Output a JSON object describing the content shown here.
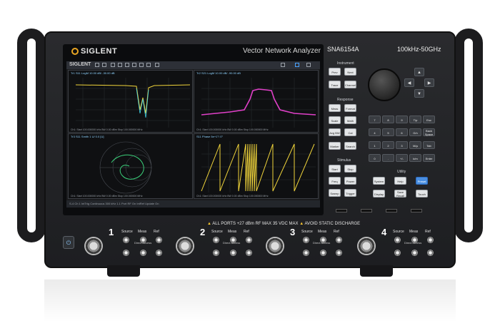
{
  "instrument": {
    "brand": "SIGLENT",
    "product_name": "Vector Network Analyzer",
    "model": "SNA6154A",
    "frequency_range": "100kHz-50GHz"
  },
  "screen": {
    "app_logo": "SIGLENT",
    "panes": [
      {
        "title": "Tr1  S11 LogM 10.00 dB/ -30.00 dB",
        "footer": "Ch1: Start 100.000000 kHz    BW 0.00 dBm    Stop 100.000000 MHz"
      },
      {
        "title": "Tr2  S21 LogM 10.00 dB/ -90.00 dB",
        "footer": "Ch1: Start 100.000000 kHz    BW 0.00 dBm    Stop 100.000000 MHz"
      },
      {
        "title": "Tr3  S11 Smith 1 U/ 0.0 [U]",
        "footer": "Ch1: Start 100.000000 kHz    BW 0.00 dBm    Stop 100.000000 MHz"
      },
      {
        "title": "S11 Phase 5e+1°/ 0°",
        "footer": "Ch1: Start 100.000000 kHz    BW 0.00 dBm    Stop 100.000000 MHz"
      }
    ],
    "statusbar": "S-4   Ch 1   IntTrig   Continuous   300 kHz   1.1 Port   RF On   IntRef   Update On"
  },
  "instrument_group": {
    "title": "Instrument",
    "keys": [
      "Prev",
      "Next",
      "Trace",
      "Channel"
    ]
  },
  "response_group": {
    "title": "Response",
    "keys": [
      "Meas",
      "Format",
      "Scale",
      "Math",
      "Avg BW",
      "Cal",
      "Marker",
      "Search"
    ]
  },
  "stimulus_group": {
    "title": "Stimulus",
    "keys": [
      "Start",
      "Stop",
      "Freq",
      "Power",
      "Sweep",
      "Trigger"
    ]
  },
  "numpad": {
    "keys": [
      "7",
      "8",
      "9",
      "T/p",
      "Esc",
      "4",
      "5",
      "6",
      "G/n",
      "Back Space",
      "1",
      "2",
      "3",
      "M/μ",
      "Tab",
      "0",
      ".",
      "+/-",
      "k/m",
      "Enter"
    ]
  },
  "utility_group": {
    "title": "Utility",
    "keys": [
      "System",
      "Help",
      "Preset",
      "Display",
      "Save Recall",
      "Touch"
    ]
  },
  "warning": {
    "text1": "ALL PORTS +27 dBm RF MAX 35 VDC MAX",
    "text2": "AVOID STATIC DISCHARGE"
  },
  "ports": [
    {
      "number": "1",
      "labels": [
        "Source",
        "Meas",
        "Ref"
      ],
      "dir_text": "Direct Access"
    },
    {
      "number": "2",
      "labels": [
        "Source",
        "Meas",
        "Ref"
      ],
      "dir_text": "Direct Access"
    },
    {
      "number": "3",
      "labels": [
        "Source",
        "Meas",
        "Ref"
      ],
      "dir_text": "Direct Access"
    },
    {
      "number": "4",
      "labels": [
        "Source",
        "Meas",
        "Ref"
      ],
      "dir_text": "Direct Access"
    }
  ],
  "colors": {
    "trace_yellow": "#f0d43a",
    "trace_magenta": "#e040c8",
    "trace_cyan": "#3fd3e8",
    "trace_green": "#3bd07a",
    "preset_key": "#4a8ee0",
    "warning_triangle": "#f2c230"
  }
}
